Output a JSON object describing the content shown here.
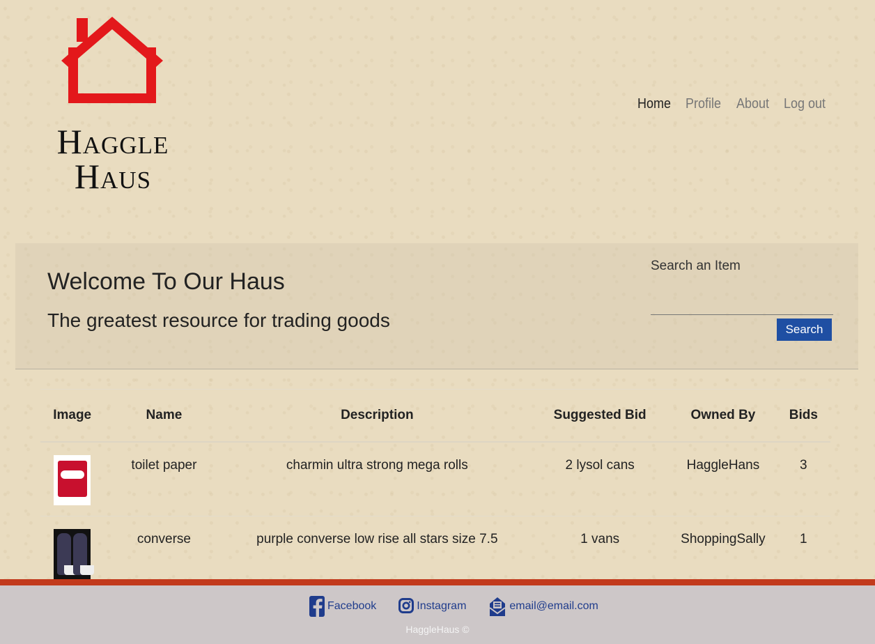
{
  "brand": {
    "name_line1": "Haggle",
    "name_line2": "Haus"
  },
  "nav": {
    "items": [
      "Home",
      "Profile",
      "About",
      "Log out"
    ]
  },
  "hero": {
    "title": "Welcome To Our Haus",
    "subtitle": "The greatest resource for trading goods",
    "search_label": "Search an Item",
    "search_placeholder": "",
    "search_button": "Search"
  },
  "table": {
    "headers": [
      "Image",
      "Name",
      "Description",
      "Suggested Bid",
      "Owned By",
      "Bids"
    ],
    "rows": [
      {
        "image": "toilet-paper-photo",
        "name": "toilet paper",
        "description": "charmin ultra strong mega rolls",
        "bid": "2 lysol cans",
        "owner": "HaggleHans",
        "bids": "3"
      },
      {
        "image": "converse-shoes-photo",
        "name": "converse",
        "description": "purple converse low rise all stars size 7.5",
        "bid": "1 vans",
        "owner": "ShoppingSally",
        "bids": "1"
      }
    ]
  },
  "footer": {
    "facebook": "Facebook",
    "instagram": "Instagram",
    "email": "email@email.com",
    "copyright": "HaggleHaus ©"
  },
  "colors": {
    "logo_red": "#e3181b",
    "button_blue": "#1f4fa3",
    "footer_bar": "#c23a1c",
    "link_blue": "#1f3c8c"
  }
}
